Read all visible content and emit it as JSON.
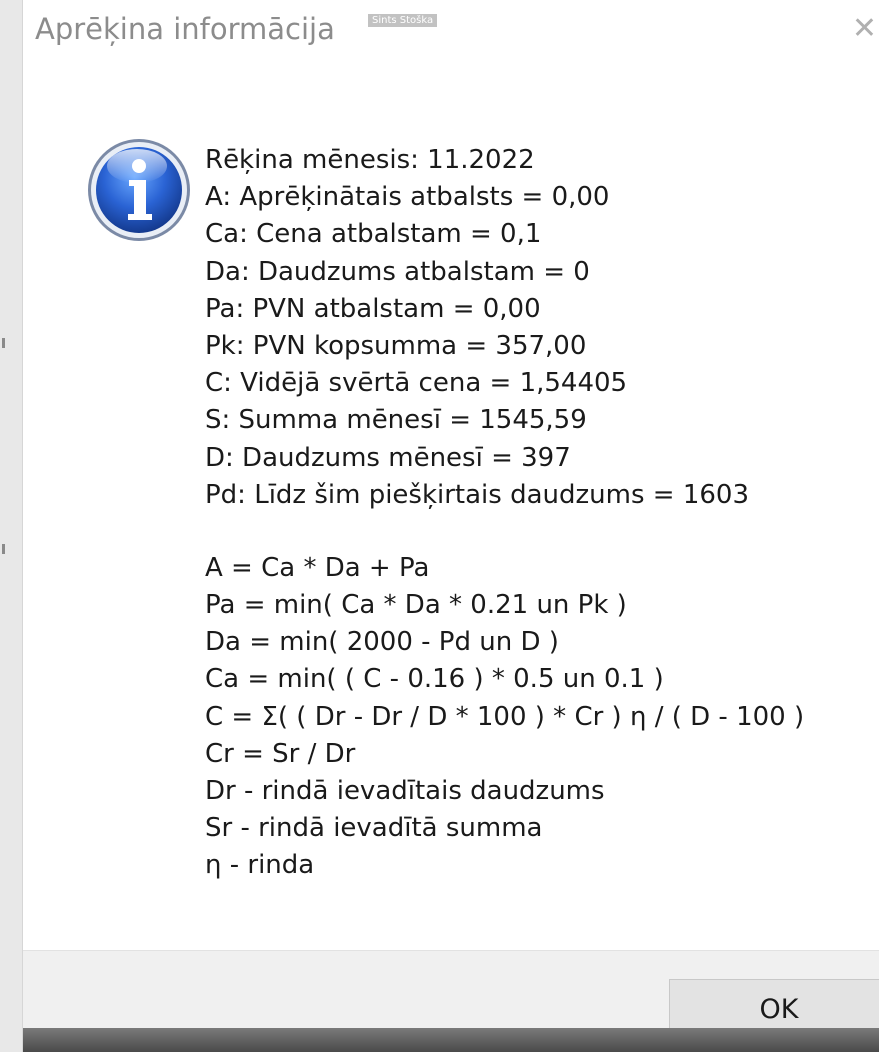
{
  "window": {
    "title": "Aprēķina informācija",
    "watermark": "Sints Stoška"
  },
  "message": {
    "lines": [
      "Rēķina mēnesis: 11.2022",
      "A: Aprēķinātais atbalsts = 0,00",
      "Ca: Cena atbalstam = 0,1",
      "Da: Daudzums atbalstam = 0",
      "Pa: PVN atbalstam = 0,00",
      "Pk: PVN kopsumma = 357,00",
      "C: Vidējā svērtā cena = 1,54405",
      "S: Summa mēnesī = 1545,59",
      "D: Daudzums mēnesī = 397",
      "Pd: Līdz šim piešķirtais daudzums = 1603"
    ],
    "formulas": [
      "A = Ca * Da + Pa",
      "Pa = min( Ca * Da * 0.21 un Pk )",
      "Da = min( 2000 - Pd un D )",
      "Ca = min( ( C - 0.16 ) * 0.5 un 0.1 )",
      "C = Σ( ( Dr - Dr / D * 100 ) * Cr ) η / ( D - 100 )",
      "Cr = Sr / Dr",
      "Dr - rindā ievadītais daudzums",
      "Sr - rindā ievadītā summa",
      "η - rinda"
    ]
  },
  "buttons": {
    "ok_label": "OK"
  },
  "icons": {
    "message_icon": "info-icon",
    "close": "close-icon"
  },
  "colors": {
    "icon_blue": "#1f56c0",
    "title_gray": "#8c8c8c",
    "footer_bg": "#f0f0f0"
  }
}
